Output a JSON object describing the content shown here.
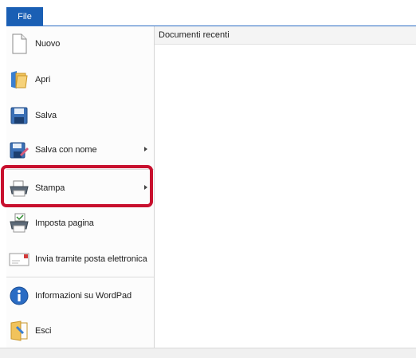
{
  "file_tab": {
    "label": "File"
  },
  "menu": {
    "items": [
      {
        "label": "Nuovo",
        "icon": "new-document-icon"
      },
      {
        "label": "Apri",
        "icon": "open-folder-icon"
      },
      {
        "label": "Salva",
        "icon": "save-icon"
      },
      {
        "label": "Salva con nome",
        "icon": "save-as-icon",
        "submenu": true
      },
      {
        "label": "Stampa",
        "icon": "printer-icon",
        "submenu": true
      },
      {
        "label": "Imposta pagina",
        "icon": "page-setup-icon"
      },
      {
        "label": "Invia tramite posta elettronica",
        "icon": "email-icon"
      },
      {
        "label": "Informazioni su WordPad",
        "icon": "info-icon"
      },
      {
        "label": "Esci",
        "icon": "exit-icon"
      }
    ]
  },
  "recent": {
    "title": "Documenti recenti"
  },
  "colors": {
    "accent": "#1a5fb4",
    "highlight": "#c8102e"
  }
}
